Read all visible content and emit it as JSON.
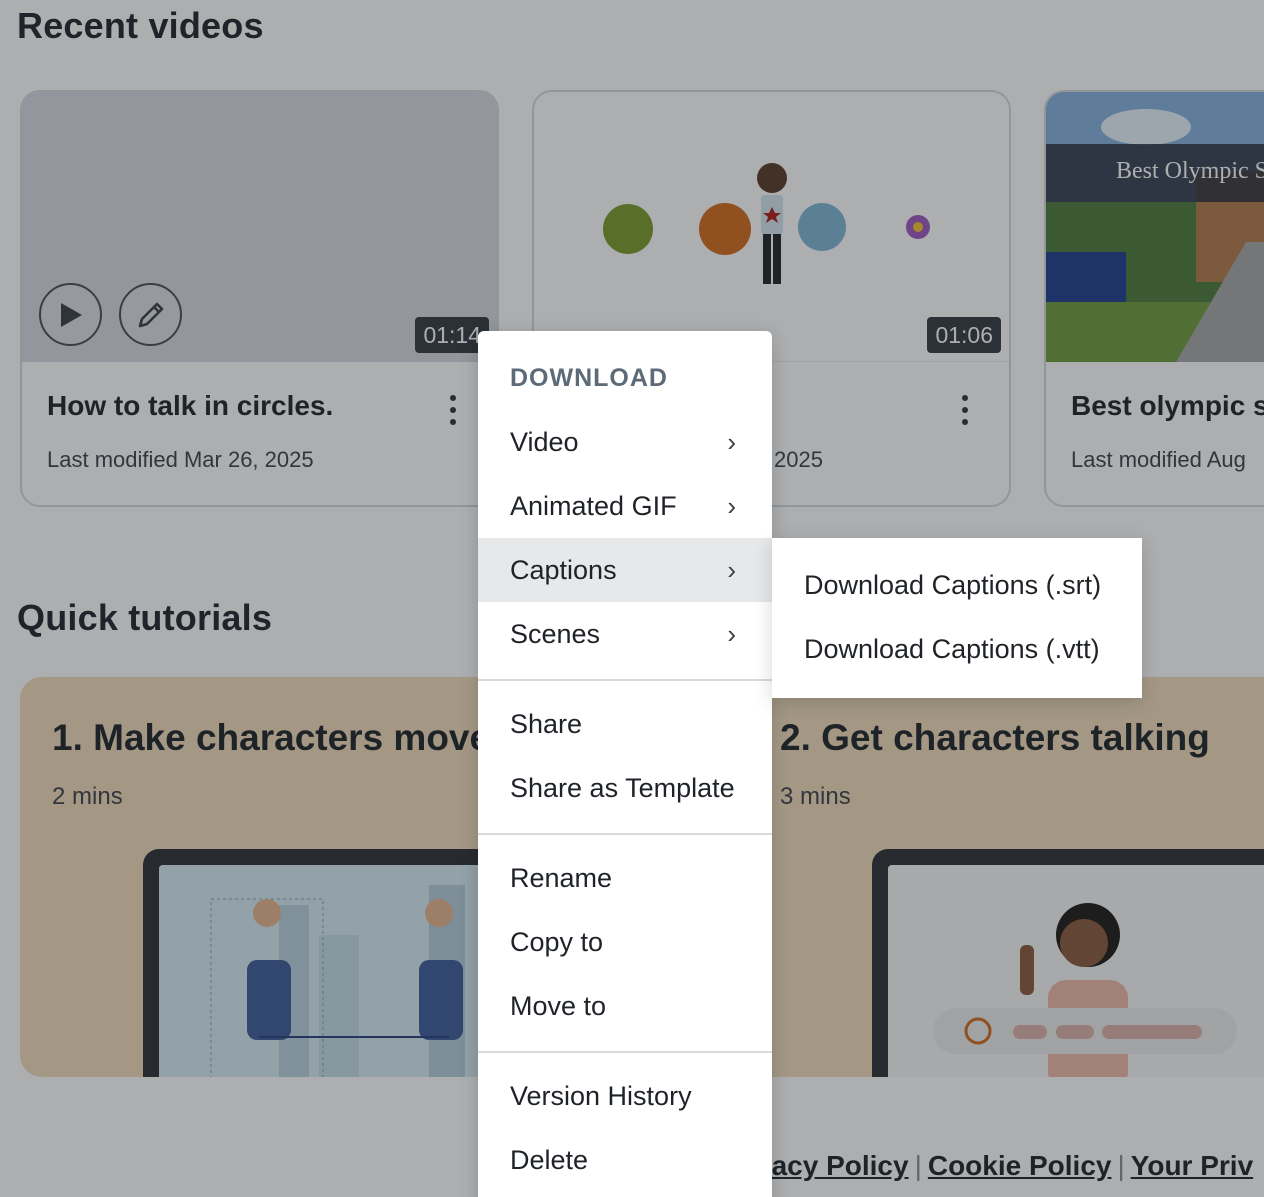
{
  "recent": {
    "title": "Recent videos",
    "cards": [
      {
        "title": "How to talk in circles.",
        "modified": "Last modified Mar 26, 2025",
        "duration": "01:14"
      },
      {
        "title": "",
        "modified": "2025",
        "duration": "01:06"
      },
      {
        "title": "Best olympic s",
        "modified": "Last modified Aug",
        "thumb_caption": "Best Olympic S"
      }
    ]
  },
  "quick": {
    "title": "Quick tutorials",
    "tutorials": [
      {
        "title": "1. Make characters move",
        "duration": "2 mins"
      },
      {
        "title": "2. Get characters talking",
        "duration": "3 mins"
      }
    ]
  },
  "footer": {
    "links": [
      "vacy Policy",
      "Cookie Policy",
      "Your Priv"
    ]
  },
  "menu": {
    "heading": "DOWNLOAD",
    "items": {
      "video": "Video",
      "gif": "Animated GIF",
      "captions": "Captions",
      "scenes": "Scenes",
      "share": "Share",
      "share_template": "Share as Template",
      "rename": "Rename",
      "copy": "Copy to",
      "move": "Move to",
      "history": "Version History",
      "delete": "Delete"
    },
    "active": "Captions"
  },
  "submenu": {
    "srt": "Download Captions (.srt)",
    "vtt": "Download Captions (.vtt)"
  },
  "colors": {
    "overlay": "#1e2228",
    "tutorial_bg": "#f2dcbb",
    "duration_bg": "#34393f",
    "menu_heading": "#5d6a78"
  }
}
